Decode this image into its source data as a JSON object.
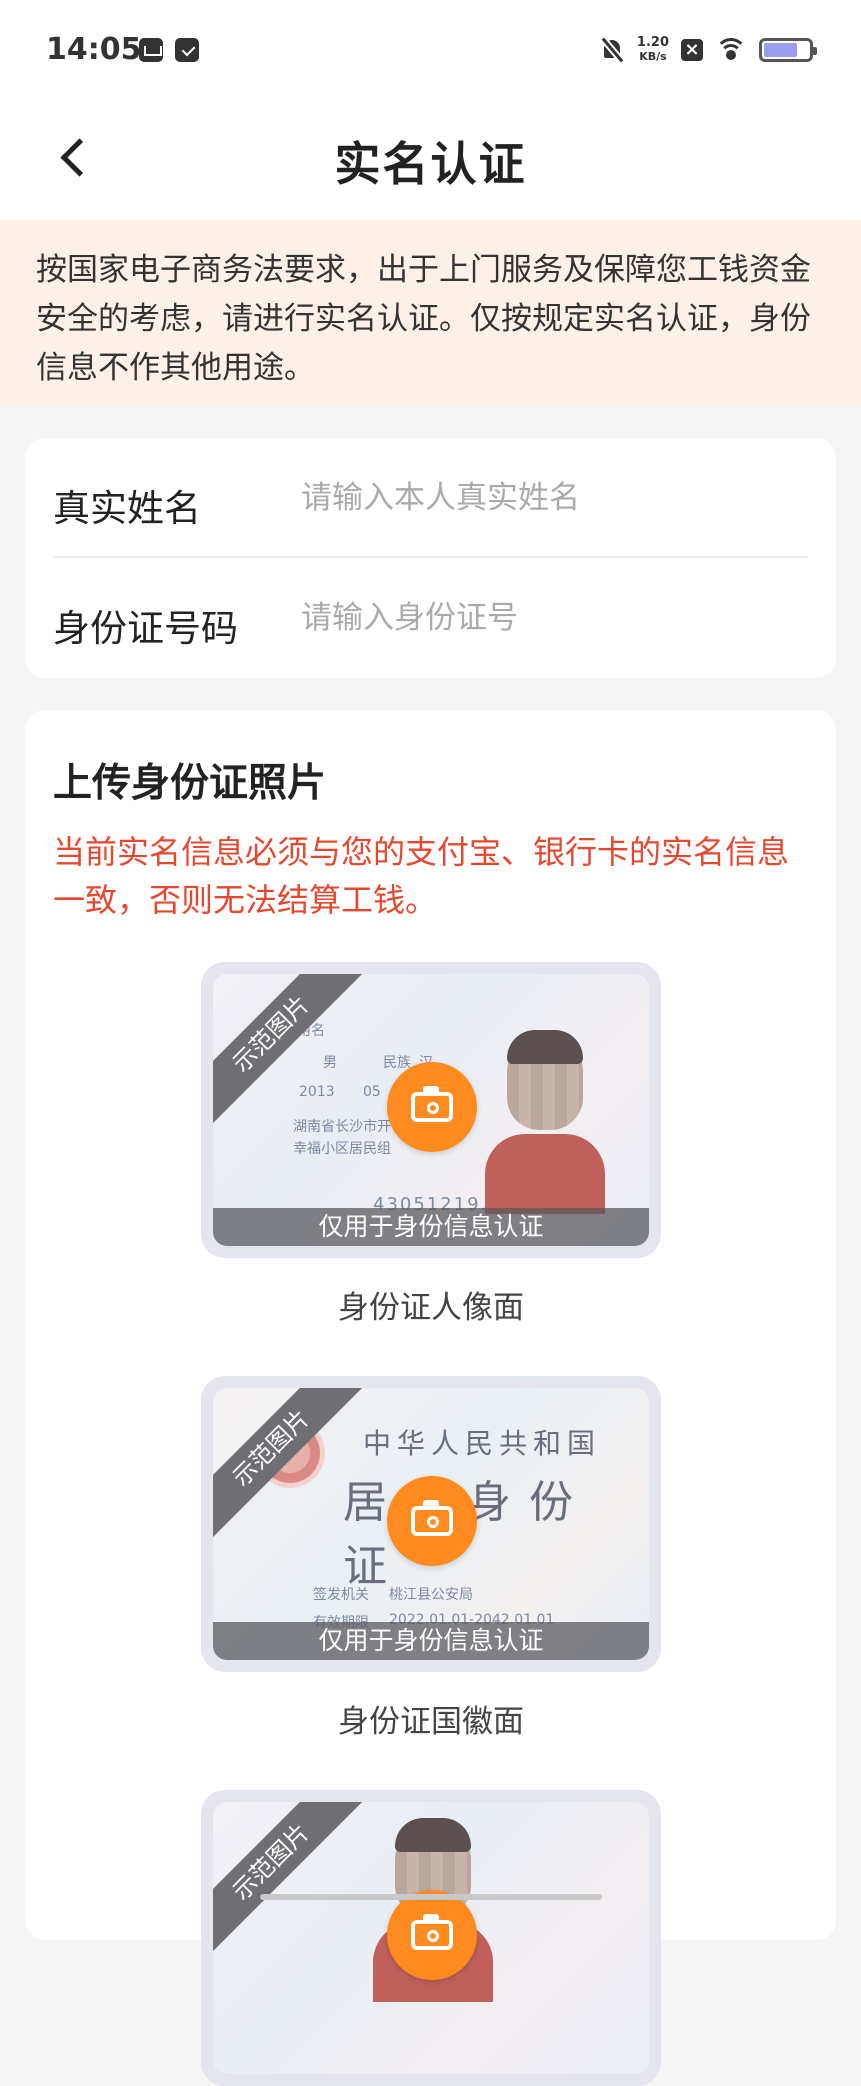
{
  "status_bar": {
    "time": "14:05",
    "net_speed_value": "1.20",
    "net_speed_unit": "KB/s",
    "battery_percent": 75
  },
  "header": {
    "title": "实名认证"
  },
  "notice": {
    "text": "按国家电子商务法要求，出于上门服务及保障您工钱资金安全的考虑，请进行实名认证。仅按规定实名认证，身份信息不作其他用途。"
  },
  "form": {
    "name_label": "真实姓名",
    "name_placeholder": "请输入本人真实姓名",
    "name_value": "",
    "id_label": "身份证号码",
    "id_placeholder": "请输入身份证号",
    "id_value": ""
  },
  "upload": {
    "title": "上传身份证照片",
    "warning": "当前实名信息必须与您的支付宝、银行卡的实名信息一致，否则无法结算工钱。",
    "sample_badge": "示范图片",
    "overlay_text": "仅用于身份信息认证",
    "items": [
      {
        "caption": "身份证人像面",
        "card_name_label": "代用名",
        "card_gender": "男",
        "card_ethnicity_label": "民族",
        "card_ethnicity": "汉",
        "card_birth_year": "2013",
        "card_birth_month": "05",
        "card_address_line1": "湖南省长沙市开",
        "card_address_line2": "幸福小区居民组",
        "card_id_number": "43051219..."
      },
      {
        "caption": "身份证国徽面",
        "card_title_1": "中华人民共和国",
        "card_title_2": "居民身份证",
        "card_authority_label": "签发机关",
        "card_authority": "桃江县公安局",
        "card_validity_label": "有效期限",
        "card_validity": "2022.01.01-2042.01.01"
      },
      {
        "caption": ""
      }
    ]
  },
  "colors": {
    "accent": "#ff8a1f",
    "warning": "#e6482f",
    "notice_bg": "#fdf0e8"
  }
}
